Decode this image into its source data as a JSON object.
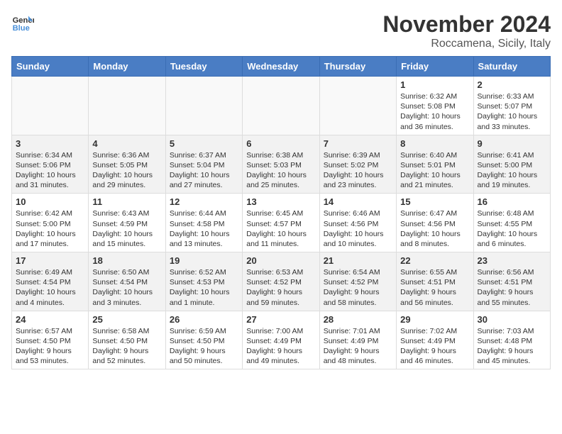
{
  "logo": {
    "line1": "General",
    "line2": "Blue"
  },
  "title": "November 2024",
  "location": "Roccamena, Sicily, Italy",
  "weekdays": [
    "Sunday",
    "Monday",
    "Tuesday",
    "Wednesday",
    "Thursday",
    "Friday",
    "Saturday"
  ],
  "weeks": [
    [
      {
        "num": "",
        "info": ""
      },
      {
        "num": "",
        "info": ""
      },
      {
        "num": "",
        "info": ""
      },
      {
        "num": "",
        "info": ""
      },
      {
        "num": "",
        "info": ""
      },
      {
        "num": "1",
        "info": "Sunrise: 6:32 AM\nSunset: 5:08 PM\nDaylight: 10 hours and 36 minutes."
      },
      {
        "num": "2",
        "info": "Sunrise: 6:33 AM\nSunset: 5:07 PM\nDaylight: 10 hours and 33 minutes."
      }
    ],
    [
      {
        "num": "3",
        "info": "Sunrise: 6:34 AM\nSunset: 5:06 PM\nDaylight: 10 hours and 31 minutes."
      },
      {
        "num": "4",
        "info": "Sunrise: 6:36 AM\nSunset: 5:05 PM\nDaylight: 10 hours and 29 minutes."
      },
      {
        "num": "5",
        "info": "Sunrise: 6:37 AM\nSunset: 5:04 PM\nDaylight: 10 hours and 27 minutes."
      },
      {
        "num": "6",
        "info": "Sunrise: 6:38 AM\nSunset: 5:03 PM\nDaylight: 10 hours and 25 minutes."
      },
      {
        "num": "7",
        "info": "Sunrise: 6:39 AM\nSunset: 5:02 PM\nDaylight: 10 hours and 23 minutes."
      },
      {
        "num": "8",
        "info": "Sunrise: 6:40 AM\nSunset: 5:01 PM\nDaylight: 10 hours and 21 minutes."
      },
      {
        "num": "9",
        "info": "Sunrise: 6:41 AM\nSunset: 5:00 PM\nDaylight: 10 hours and 19 minutes."
      }
    ],
    [
      {
        "num": "10",
        "info": "Sunrise: 6:42 AM\nSunset: 5:00 PM\nDaylight: 10 hours and 17 minutes."
      },
      {
        "num": "11",
        "info": "Sunrise: 6:43 AM\nSunset: 4:59 PM\nDaylight: 10 hours and 15 minutes."
      },
      {
        "num": "12",
        "info": "Sunrise: 6:44 AM\nSunset: 4:58 PM\nDaylight: 10 hours and 13 minutes."
      },
      {
        "num": "13",
        "info": "Sunrise: 6:45 AM\nSunset: 4:57 PM\nDaylight: 10 hours and 11 minutes."
      },
      {
        "num": "14",
        "info": "Sunrise: 6:46 AM\nSunset: 4:56 PM\nDaylight: 10 hours and 10 minutes."
      },
      {
        "num": "15",
        "info": "Sunrise: 6:47 AM\nSunset: 4:56 PM\nDaylight: 10 hours and 8 minutes."
      },
      {
        "num": "16",
        "info": "Sunrise: 6:48 AM\nSunset: 4:55 PM\nDaylight: 10 hours and 6 minutes."
      }
    ],
    [
      {
        "num": "17",
        "info": "Sunrise: 6:49 AM\nSunset: 4:54 PM\nDaylight: 10 hours and 4 minutes."
      },
      {
        "num": "18",
        "info": "Sunrise: 6:50 AM\nSunset: 4:54 PM\nDaylight: 10 hours and 3 minutes."
      },
      {
        "num": "19",
        "info": "Sunrise: 6:52 AM\nSunset: 4:53 PM\nDaylight: 10 hours and 1 minute."
      },
      {
        "num": "20",
        "info": "Sunrise: 6:53 AM\nSunset: 4:52 PM\nDaylight: 9 hours and 59 minutes."
      },
      {
        "num": "21",
        "info": "Sunrise: 6:54 AM\nSunset: 4:52 PM\nDaylight: 9 hours and 58 minutes."
      },
      {
        "num": "22",
        "info": "Sunrise: 6:55 AM\nSunset: 4:51 PM\nDaylight: 9 hours and 56 minutes."
      },
      {
        "num": "23",
        "info": "Sunrise: 6:56 AM\nSunset: 4:51 PM\nDaylight: 9 hours and 55 minutes."
      }
    ],
    [
      {
        "num": "24",
        "info": "Sunrise: 6:57 AM\nSunset: 4:50 PM\nDaylight: 9 hours and 53 minutes."
      },
      {
        "num": "25",
        "info": "Sunrise: 6:58 AM\nSunset: 4:50 PM\nDaylight: 9 hours and 52 minutes."
      },
      {
        "num": "26",
        "info": "Sunrise: 6:59 AM\nSunset: 4:50 PM\nDaylight: 9 hours and 50 minutes."
      },
      {
        "num": "27",
        "info": "Sunrise: 7:00 AM\nSunset: 4:49 PM\nDaylight: 9 hours and 49 minutes."
      },
      {
        "num": "28",
        "info": "Sunrise: 7:01 AM\nSunset: 4:49 PM\nDaylight: 9 hours and 48 minutes."
      },
      {
        "num": "29",
        "info": "Sunrise: 7:02 AM\nSunset: 4:49 PM\nDaylight: 9 hours and 46 minutes."
      },
      {
        "num": "30",
        "info": "Sunrise: 7:03 AM\nSunset: 4:48 PM\nDaylight: 9 hours and 45 minutes."
      }
    ]
  ]
}
